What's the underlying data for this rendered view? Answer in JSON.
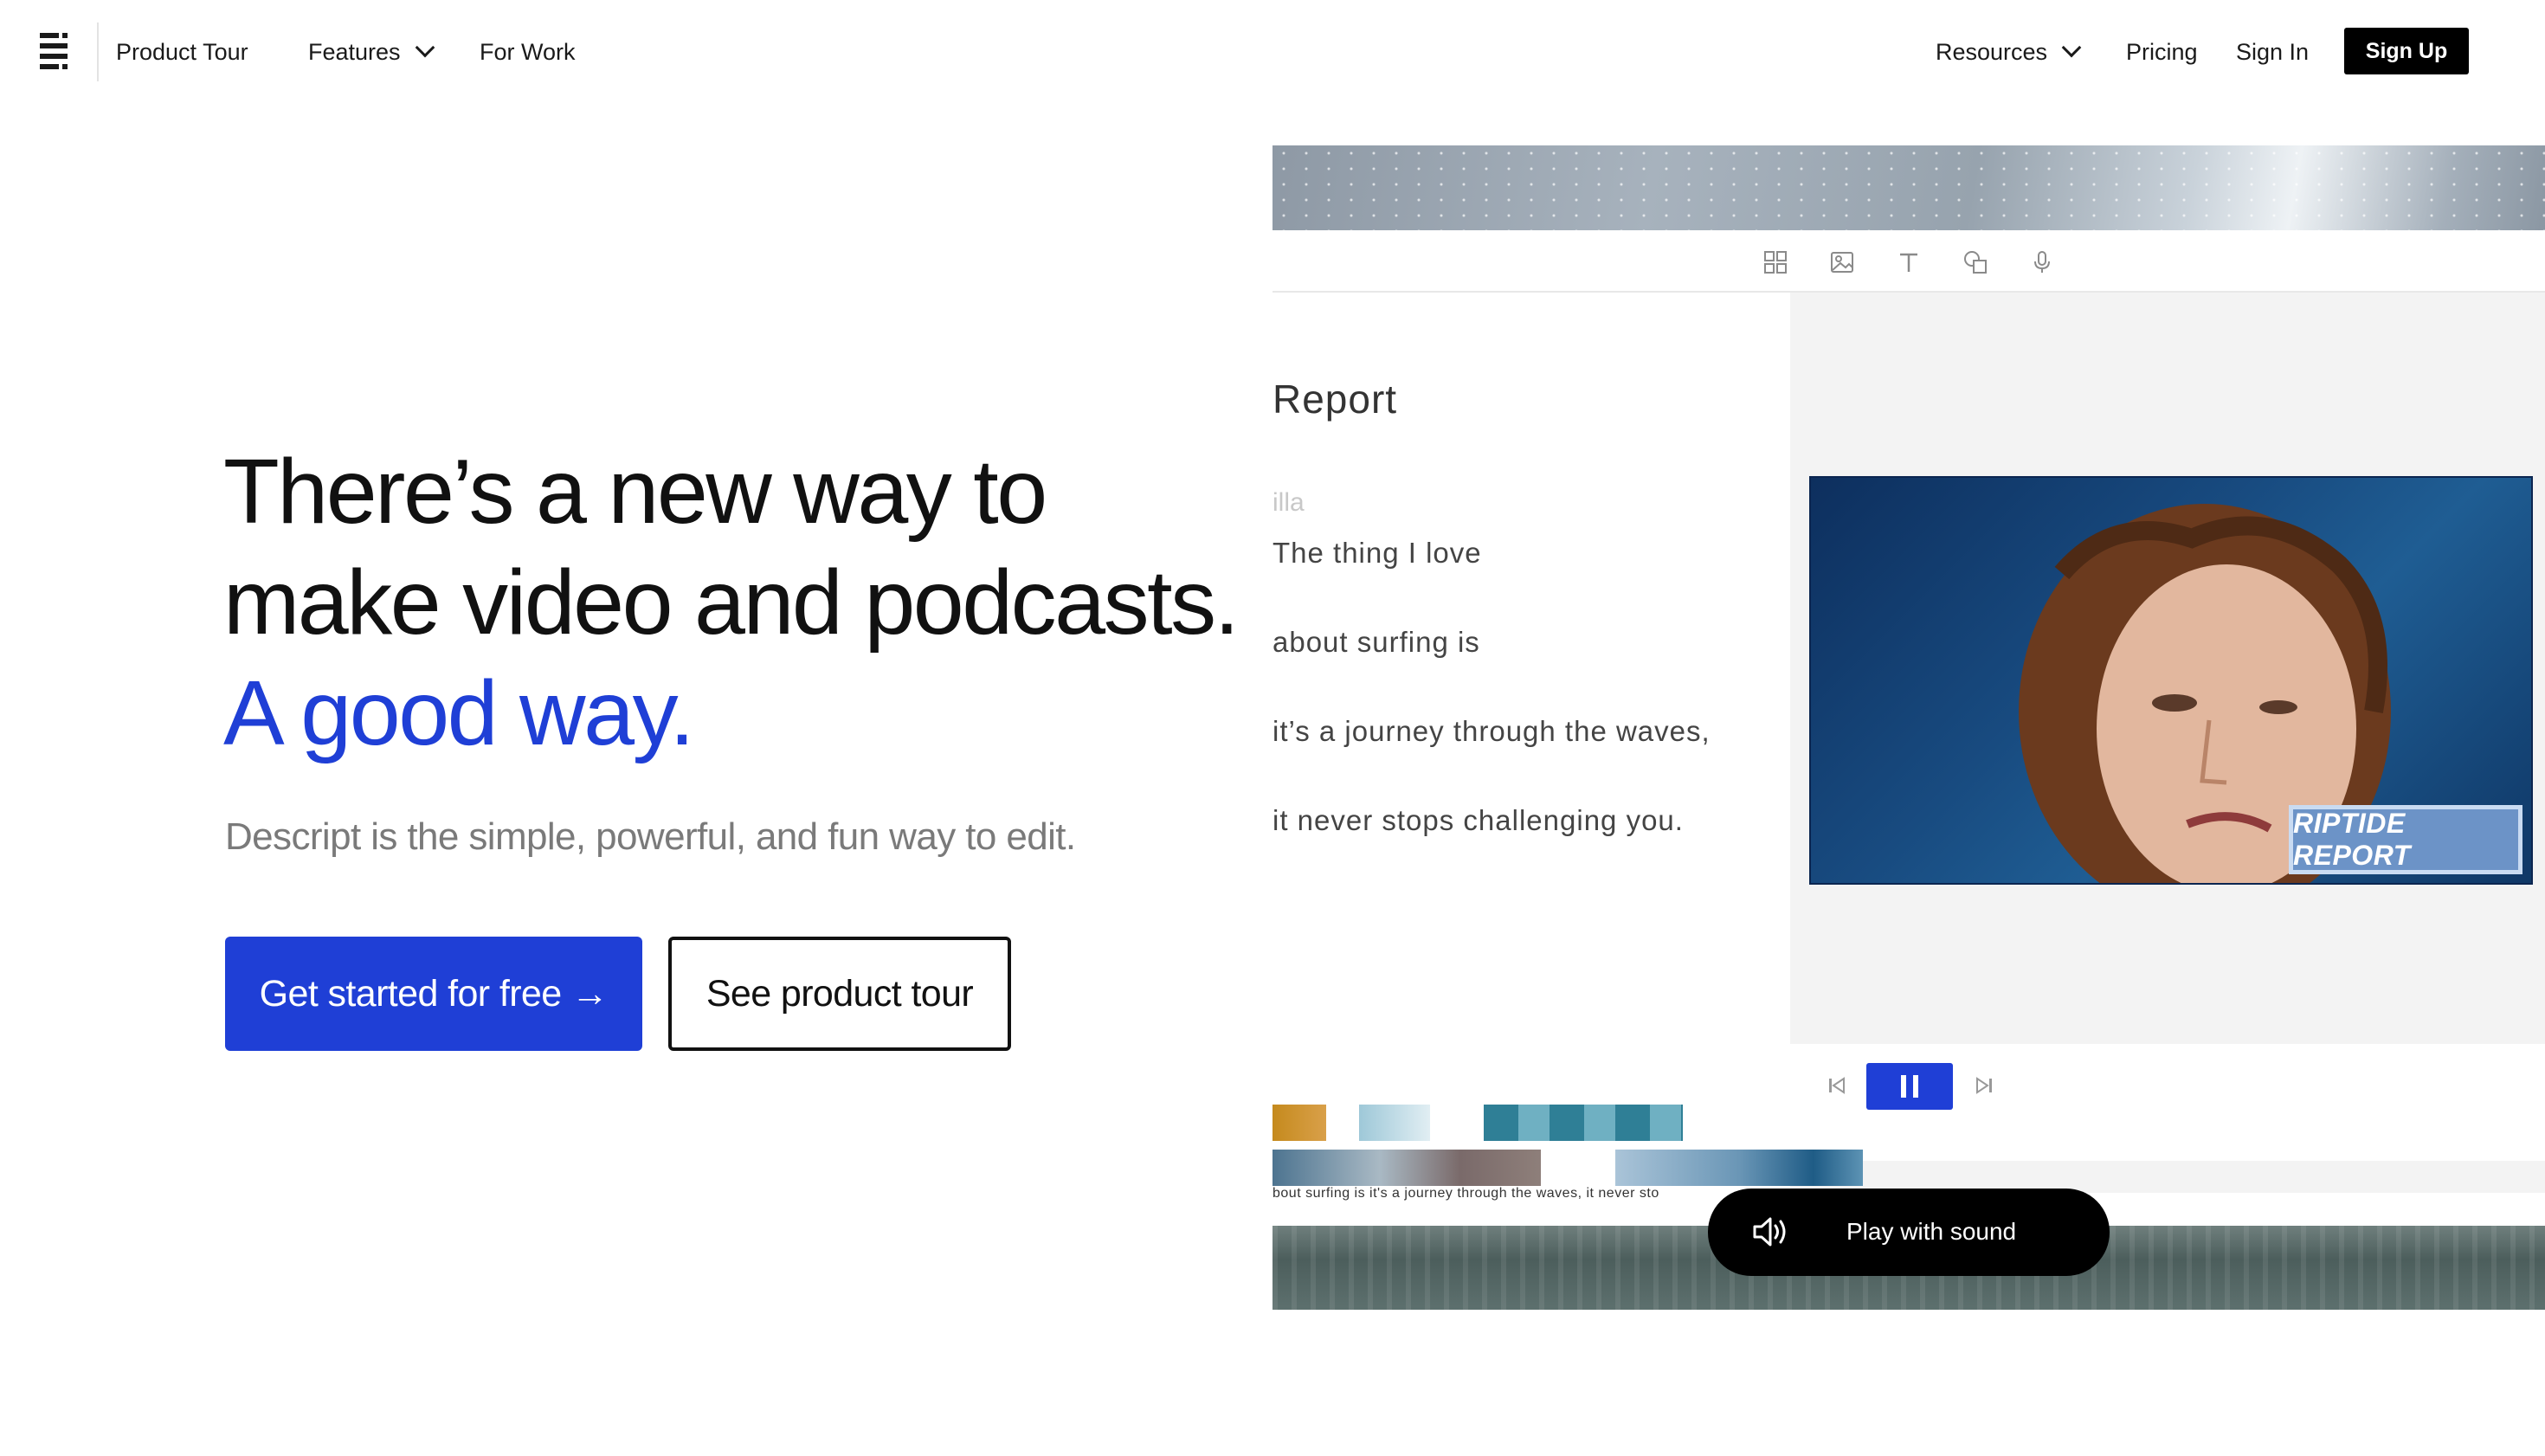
{
  "nav": {
    "product_tour": "Product Tour",
    "features": "Features",
    "for_work": "For Work",
    "resources": "Resources",
    "pricing": "Pricing",
    "sign_in": "Sign In",
    "sign_up": "Sign Up"
  },
  "hero": {
    "headline_main": "There’s a new way to make video and podcasts.",
    "headline_accent": "A good way.",
    "subtitle": "Descript is the simple, powerful, and fun way to edit.",
    "cta_primary": "Get started for free →",
    "cta_secondary": "See product tour"
  },
  "demo": {
    "doc_title": "Report",
    "speaker": "illa",
    "transcript": [
      "The thing I love",
      "about surfing is",
      "it’s a journey through the waves,",
      "it never stops challenging you."
    ],
    "video_badge": "RIPTIDE REPORT",
    "clip_caption": "bout surfing is it's a journey through the waves, it never sto",
    "sound_button": "Play with sound"
  },
  "colors": {
    "accent": "#1f3fd6",
    "nav_button": "#000000",
    "subtitle": "#7a7a7a"
  },
  "icons": {
    "logo": "descript-logo-icon",
    "toolbar": [
      "grid-icon",
      "image-icon",
      "text-icon",
      "shapes-icon",
      "microphone-icon"
    ],
    "transport": [
      "skip-back-icon",
      "pause-icon",
      "skip-forward-icon"
    ],
    "sound": "speaker-icon"
  }
}
